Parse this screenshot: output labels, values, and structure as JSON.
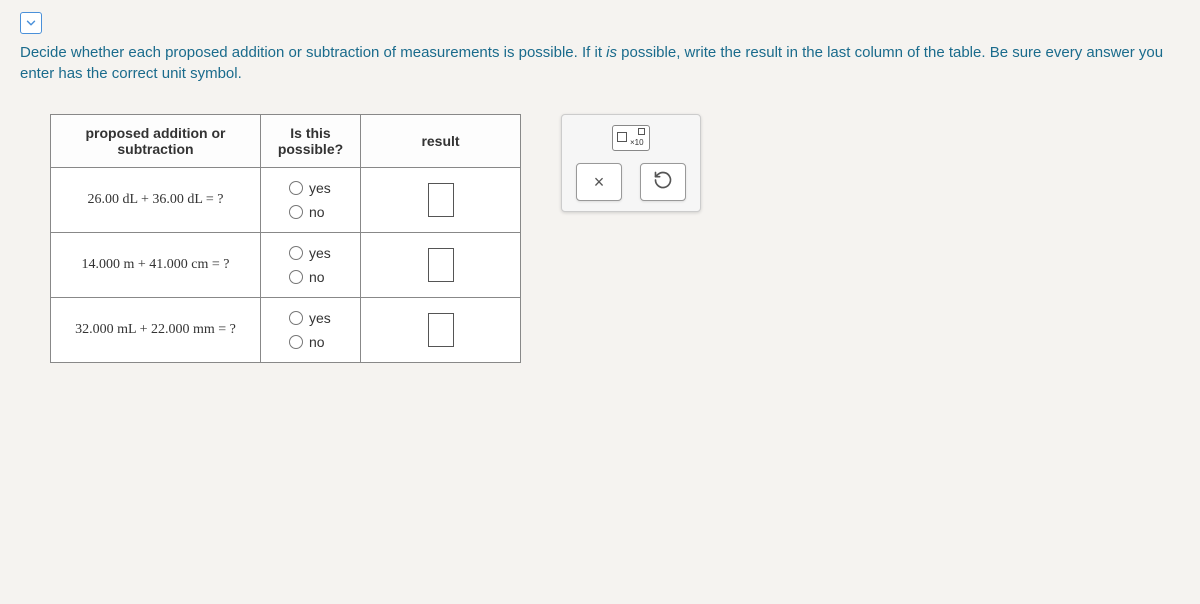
{
  "instructionPart1": "Decide whether each proposed addition or subtraction of measurements is possible. If it ",
  "instructionItalic": "is",
  "instructionPart2": " possible, write the result in the last column of the table. Be sure every answer you enter has the correct unit symbol.",
  "table": {
    "headers": {
      "proposed": "proposed addition or subtraction",
      "possible": "Is this possible?",
      "result": "result"
    },
    "options": {
      "yes": "yes",
      "no": "no"
    },
    "rows": [
      {
        "equation": "26.00 dL + 36.00 dL = ?",
        "result": ""
      },
      {
        "equation": "14.000 m + 41.000 cm = ?",
        "result": ""
      },
      {
        "equation": "32.000 mL + 22.000 mm = ?",
        "result": ""
      }
    ]
  },
  "toolbox": {
    "sciNotationLabel": "×10",
    "clearLabel": "×",
    "resetLabel": "↺"
  }
}
